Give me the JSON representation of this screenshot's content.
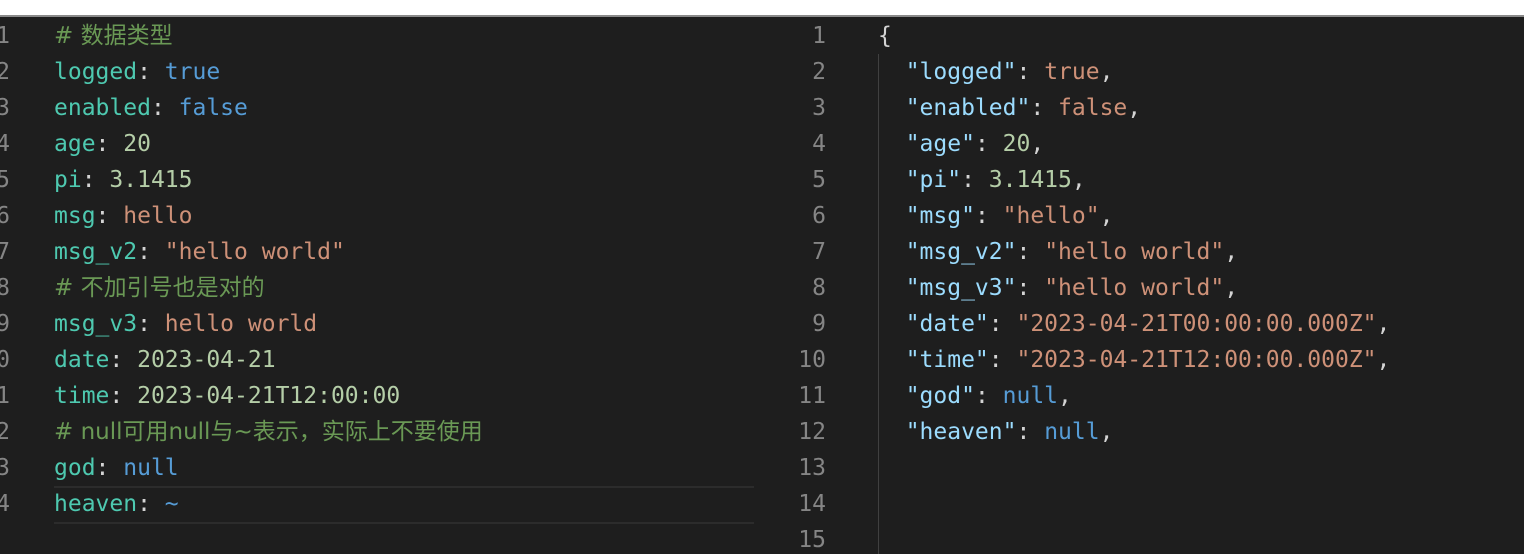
{
  "yaml_editor": {
    "gutter_partial": [
      "1",
      "2",
      "3",
      "4",
      "5",
      "6",
      "7",
      "8",
      "9",
      "0",
      "1",
      "2",
      "3",
      "4"
    ],
    "lines": [
      [
        {
          "t": "cmt",
          "v": "# 数据类型"
        }
      ],
      [
        {
          "t": "key",
          "v": "logged"
        },
        {
          "t": "pun",
          "v": ": "
        },
        {
          "t": "kw",
          "v": "true"
        }
      ],
      [
        {
          "t": "key",
          "v": "enabled"
        },
        {
          "t": "pun",
          "v": ": "
        },
        {
          "t": "kw",
          "v": "false"
        }
      ],
      [
        {
          "t": "key",
          "v": "age"
        },
        {
          "t": "pun",
          "v": ": "
        },
        {
          "t": "num",
          "v": "20"
        }
      ],
      [
        {
          "t": "key",
          "v": "pi"
        },
        {
          "t": "pun",
          "v": ": "
        },
        {
          "t": "num",
          "v": "3.1415"
        }
      ],
      [
        {
          "t": "key",
          "v": "msg"
        },
        {
          "t": "pun",
          "v": ": "
        },
        {
          "t": "str",
          "v": "hello"
        }
      ],
      [
        {
          "t": "key",
          "v": "msg_v2"
        },
        {
          "t": "pun",
          "v": ": "
        },
        {
          "t": "str",
          "v": "\"hello world\""
        }
      ],
      [
        {
          "t": "cmt",
          "v": "# 不加引号也是对的"
        }
      ],
      [
        {
          "t": "key",
          "v": "msg_v3"
        },
        {
          "t": "pun",
          "v": ": "
        },
        {
          "t": "str",
          "v": "hello world"
        }
      ],
      [
        {
          "t": "key",
          "v": "date"
        },
        {
          "t": "pun",
          "v": ": "
        },
        {
          "t": "num",
          "v": "2023-04-21"
        }
      ],
      [
        {
          "t": "key",
          "v": "time"
        },
        {
          "t": "pun",
          "v": ": "
        },
        {
          "t": "num",
          "v": "2023-04-21T12:00:00"
        }
      ],
      [
        {
          "t": "cmt",
          "v": "# null可用null与~表示，实际上不要使用"
        }
      ],
      [
        {
          "t": "key",
          "v": "god"
        },
        {
          "t": "pun",
          "v": ": "
        },
        {
          "t": "kw",
          "v": "null"
        }
      ],
      [
        {
          "t": "key",
          "v": "heaven"
        },
        {
          "t": "pun",
          "v": ": "
        },
        {
          "t": "kw",
          "v": "~"
        }
      ]
    ]
  },
  "json_editor": {
    "line_numbers": [
      "1",
      "2",
      "3",
      "4",
      "5",
      "6",
      "7",
      "8",
      "9",
      "10",
      "11",
      "12",
      "13",
      "14",
      "15"
    ],
    "lines": [
      [
        {
          "t": "pun",
          "v": "{"
        }
      ],
      [
        {
          "t": "jkey",
          "v": "  \"logged\""
        },
        {
          "t": "pun",
          "v": ": "
        },
        {
          "t": "str",
          "v": "true"
        },
        {
          "t": "pun",
          "v": ","
        }
      ],
      [
        {
          "t": "jkey",
          "v": "  \"enabled\""
        },
        {
          "t": "pun",
          "v": ": "
        },
        {
          "t": "str",
          "v": "false"
        },
        {
          "t": "pun",
          "v": ","
        }
      ],
      [
        {
          "t": "jkey",
          "v": "  \"age\""
        },
        {
          "t": "pun",
          "v": ": "
        },
        {
          "t": "num",
          "v": "20"
        },
        {
          "t": "pun",
          "v": ","
        }
      ],
      [
        {
          "t": "jkey",
          "v": "  \"pi\""
        },
        {
          "t": "pun",
          "v": ": "
        },
        {
          "t": "num",
          "v": "3.1415"
        },
        {
          "t": "pun",
          "v": ","
        }
      ],
      [
        {
          "t": "jkey",
          "v": "  \"msg\""
        },
        {
          "t": "pun",
          "v": ": "
        },
        {
          "t": "str",
          "v": "\"hello\""
        },
        {
          "t": "pun",
          "v": ","
        }
      ],
      [
        {
          "t": "jkey",
          "v": "  \"msg_v2\""
        },
        {
          "t": "pun",
          "v": ": "
        },
        {
          "t": "str",
          "v": "\"hello world\""
        },
        {
          "t": "pun",
          "v": ","
        }
      ],
      [
        {
          "t": "jkey",
          "v": "  \"msg_v3\""
        },
        {
          "t": "pun",
          "v": ": "
        },
        {
          "t": "str",
          "v": "\"hello world\""
        },
        {
          "t": "pun",
          "v": ","
        }
      ],
      [
        {
          "t": "jkey",
          "v": "  \"date\""
        },
        {
          "t": "pun",
          "v": ": "
        },
        {
          "t": "str",
          "v": "\"2023-04-21T00:00:00.000Z\""
        },
        {
          "t": "pun",
          "v": ","
        }
      ],
      [
        {
          "t": "jkey",
          "v": "  \"time\""
        },
        {
          "t": "pun",
          "v": ": "
        },
        {
          "t": "str",
          "v": "\"2023-04-21T12:00:00.000Z\""
        },
        {
          "t": "pun",
          "v": ","
        }
      ],
      [
        {
          "t": "jkey",
          "v": "  \"god\""
        },
        {
          "t": "pun",
          "v": ": "
        },
        {
          "t": "kw",
          "v": "null"
        },
        {
          "t": "pun",
          "v": ","
        }
      ],
      [
        {
          "t": "jkey",
          "v": "  \"heaven\""
        },
        {
          "t": "pun",
          "v": ": "
        },
        {
          "t": "kw",
          "v": "null"
        },
        {
          "t": "pun",
          "v": ","
        }
      ],
      [],
      [],
      []
    ]
  },
  "colors": {
    "background": "#1e1e1e",
    "yaml_key": "#4ec9b0",
    "json_key": "#9cdcfe",
    "keyword": "#569cd6",
    "number": "#b5cea8",
    "string": "#ce9178",
    "comment": "#6a9955",
    "line_number": "#858585"
  }
}
